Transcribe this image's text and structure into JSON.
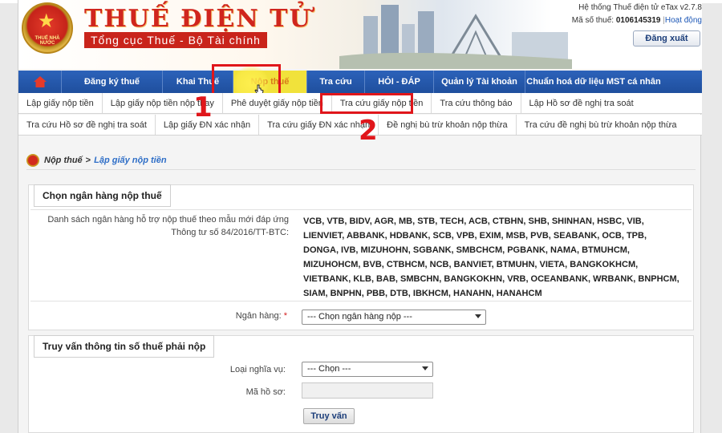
{
  "header": {
    "logo_title": "THUẾ ĐIỆN TỬ",
    "logo_subtitle": "Tổng cục Thuế - Bộ Tài chính",
    "emblem_text": "THUẾ NHÀ NƯỚC",
    "system_name": "Hệ thống Thuế điện tử eTax v2.7.8",
    "tax_id_label": "Mã số thuế:",
    "tax_id_value": "0106145319",
    "status_link": "Hoạt động",
    "logout_label": "Đăng xuất"
  },
  "main_nav": {
    "items": [
      {
        "label": "Đăng ký thuế",
        "width": 126
      },
      {
        "label": "Khai Thuế",
        "width": 88
      },
      {
        "label": "Nộp thuế",
        "width": 92,
        "active": true
      },
      {
        "label": "Tra cứu",
        "width": 72
      },
      {
        "label": "HỎI - ĐÁP",
        "width": 86
      },
      {
        "label": "Quản lý Tài khoản",
        "width": 114
      },
      {
        "label": "Chuẩn hoá dữ liệu MST cá nhân",
        "width": 152
      }
    ]
  },
  "sub_nav_row1": [
    "Lập giấy nộp tiền",
    "Lập giấy nộp tiền nộp thay",
    "Phê duyệt giấy nộp tiền",
    "Tra cứu giấy nộp tiền",
    "Tra cứu thông báo",
    "Lập Hồ sơ đề nghị tra soát"
  ],
  "sub_nav_row2": [
    "Tra cứu Hồ sơ đề nghị tra soát",
    "Lập giấy ĐN xác nhận",
    "Tra cứu giấy ĐN xác nhận",
    "Đề nghị bù trừ khoản nộp thừa",
    "Tra cứu đề nghị bù trừ khoản nộp thừa"
  ],
  "annotations": {
    "step1": "1",
    "step2": "2"
  },
  "breadcrumb": {
    "home": "Nộp thuế",
    "separator": ">",
    "current": "Lập giấy nộp tiền"
  },
  "bank_section": {
    "legend": "Chọn ngân hàng nộp thuế",
    "list_label": "Danh sách ngân hàng hỗ trợ nộp thuế theo mẫu mới đáp ứng Thông tư số 84/2016/TT-BTC:",
    "bank_list": "VCB, VTB, BIDV, AGR, MB, STB, TECH, ACB, CTBHN, SHB, SHINHAN, HSBC, VIB, LIENVIET, ABBANK, HDBANK, SCB, VPB, EXIM, MSB, PVB, SEABANK, OCB, TPB, DONGA, IVB, MIZUHOHN, SGBANK, SMBCHCM, PGBANK, NAMA, BTMUHCM, MIZUHOHCM, BVB, CTBHCM, NCB, BANVIET, BTMUHN, VIETA, BANGKOKHCM, VIETBANK, KLB, BAB, SMBCHN, BANGKOKHN, VRB, OCEANBANK, WRBANK, BNPHCM, SIAM, BNPHN, PBB, DTB, IBKHCM, HANAHN, HANAHCM",
    "bank_label": "Ngân hàng:",
    "required_mark": "*",
    "bank_select": "--- Chọn ngân hàng nộp ---"
  },
  "query_section": {
    "legend": "Truy vấn thông tin số thuế phải nộp",
    "obligation_label": "Loại nghĩa vụ:",
    "obligation_select": "--- Chọn ---",
    "file_code_label": "Mã hồ sơ:",
    "query_button": "Truy vấn"
  },
  "colors": {
    "nav_blue": "#2456a8",
    "active_tab": "#f1e23b",
    "highlight_red": "#e0161b",
    "brand_red": "#d0261e"
  }
}
